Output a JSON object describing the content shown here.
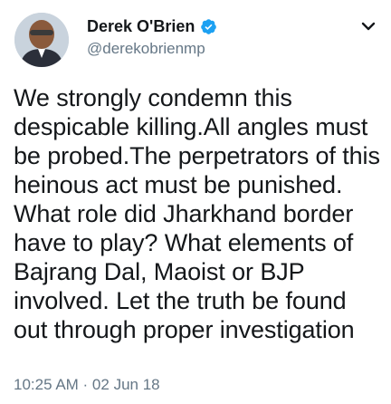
{
  "author": {
    "display_name": "Derek O'Brien",
    "handle": "@derekobrienmp",
    "verified": true
  },
  "tweet": {
    "text": "We strongly condemn this despicable killing.All angles must be probed.The perpetrators of this heinous act must be punished. What role did Jharkhand border have to play? What elements of Bajrang Dal, Maoist or BJP involved. Let the truth be found out through proper investigation",
    "timestamp": "10:25 AM · 02 Jun 18"
  },
  "icons": {
    "verified": "verified-badge-icon",
    "menu": "chevron-down-icon"
  },
  "colors": {
    "verified_blue": "#1da1f2",
    "text_primary": "#14171a",
    "text_secondary": "#657786"
  }
}
